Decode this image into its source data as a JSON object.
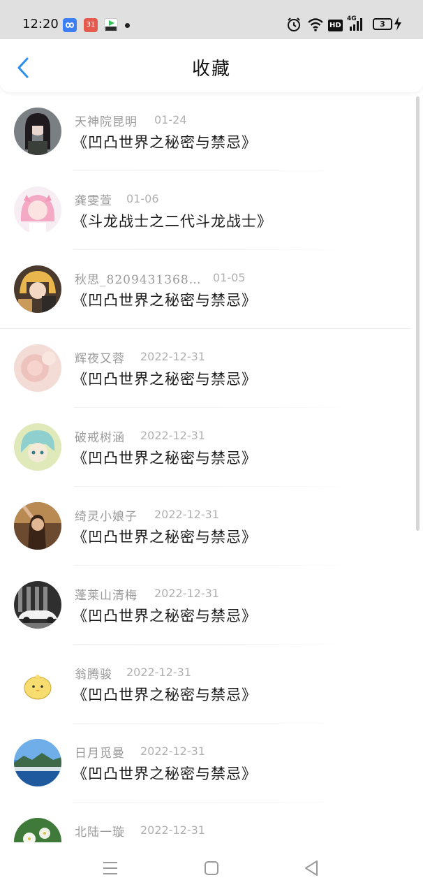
{
  "status_bar": {
    "time": "12:20",
    "notification_icons": [
      "infinity-app-icon",
      "calendar-app-icon",
      "video-app-icon"
    ],
    "calendar_badge": "31",
    "indicators": [
      "alarm-icon",
      "wifi-icon",
      "hd-icon",
      "4g-signal-icon",
      "battery-icon"
    ],
    "hd_label": "HD",
    "network_label": "4G",
    "battery_level": "3"
  },
  "header": {
    "back_icon": "chevron-left-icon",
    "title": "收藏"
  },
  "favorites": [
    {
      "name": "天神院昆明",
      "date": "01-24",
      "title": "《凹凸世界之秘密与禁忌》"
    },
    {
      "name": "龚雯萱",
      "date": "01-06",
      "title": "《斗龙战士之二代斗龙战士》"
    },
    {
      "name": "秋思_8209431368…",
      "date": "01-05",
      "title": "《凹凸世界之秘密与禁忌》"
    },
    {
      "name": "辉夜又蓉",
      "date": "2022-12-31",
      "title": "《凹凸世界之秘密与禁忌》"
    },
    {
      "name": "破戒树涵",
      "date": "2022-12-31",
      "title": "《凹凸世界之秘密与禁忌》"
    },
    {
      "name": "绮灵小娘子",
      "date": "2022-12-31",
      "title": "《凹凸世界之秘密与禁忌》"
    },
    {
      "name": "蓬莱山清梅",
      "date": "2022-12-31",
      "title": "《凹凸世界之秘密与禁忌》"
    },
    {
      "name": "翁腾骏",
      "date": "2022-12-31",
      "title": "《凹凸世界之秘密与禁忌》"
    },
    {
      "name": "日月觅曼",
      "date": "2022-12-31",
      "title": "《凹凸世界之秘密与禁忌》"
    },
    {
      "name": "北陆一璇",
      "date": "2022-12-31",
      "title": ""
    }
  ],
  "nav_bar": {
    "icons": [
      "menu-icon",
      "home-square-icon",
      "back-triangle-icon"
    ]
  },
  "colors": {
    "accent": "#2b8ff0",
    "name_text": "#9a9a9a",
    "date_text": "#b0b0b0",
    "title_text": "#1a1a1a",
    "status_bar_bg": "#e0e0e0"
  }
}
